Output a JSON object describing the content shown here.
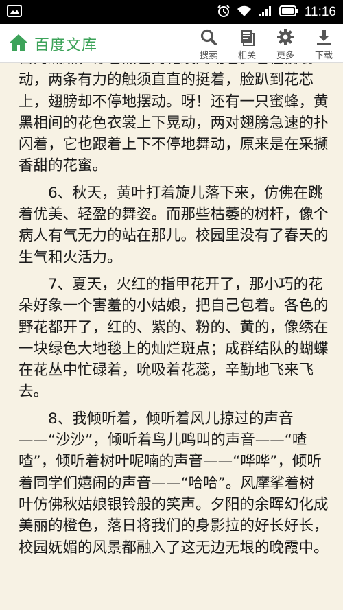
{
  "status_bar": {
    "time": "11:16",
    "icons": [
      "gallery-icon",
      "alarm-icon",
      "wifi-icon",
      "signal-icon",
      "battery-icon"
    ]
  },
  "header": {
    "app_title": "百度文库",
    "logo_icon": "home-icon",
    "accent_color": "#3da35a",
    "actions": [
      {
        "label": "搜索",
        "icon": "search-icon"
      },
      {
        "label": "相关",
        "icon": "document-icon"
      },
      {
        "label": "更多",
        "icon": "gear-icon"
      },
      {
        "label": "下载",
        "icon": "download-icon"
      }
    ]
  },
  "article": {
    "paragraphs": [
      "白的蝴蝶，你看黑色的花纹闪动着。它往前翕动，两条有力的触须直直的挺着，脸趴到花芯上，翅膀却不停地摆动。呀！还有一只蜜蜂，黄黑相间的花色衣裳上下晃动，两对翅膀急速的扑闪着，它也跟着上下不停地舞动，原来是在采撷香甜的花蜜。",
      "6、秋天，黄叶打着旋儿落下来，仿佛在跳着优美、轻盈的舞姿。而那些枯萎的树杆，像个病人有气无力的站在那儿。校园里没有了春天的生气和火活力。",
      "7、夏天，火红的指甲花开了，那小巧的花朵好象一个害羞的小姑娘，把自己包着。各色的野花都开了，红的、紫的、粉的、黄的，像绣在一块绿色大地毯上的灿烂斑点；成群结队的蝴蝶在花丛中忙碌着，吮吸着花蕊，辛勤地飞来飞去。",
      "8、我倾听着，倾听着风儿掠过的声音——“沙沙”，倾听着鸟儿鸣叫的声音——“喳喳”，倾听着树叶呢喃的声音——“哗哗”，倾听着同学们嬉闹的声音——“哈哈”。风摩挲着树叶仿佛秋姑娘银铃般的笑声。夕阳的余晖幻化成美丽的橙色，落日将我们的身影拉的好长好长，校园妩媚的风景都融入了这无边无垠的晚霞中。"
    ]
  }
}
